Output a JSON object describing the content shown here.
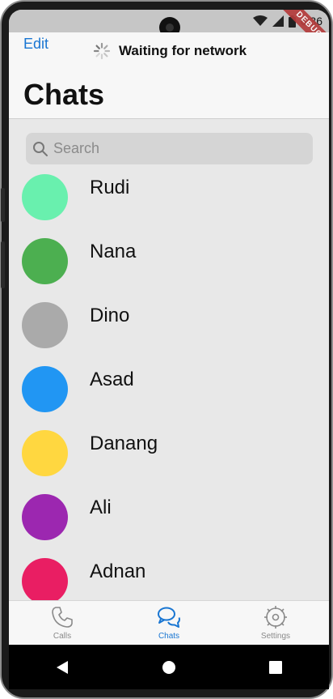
{
  "status_bar": {
    "time": "6:36",
    "debug_label": "DEBUG"
  },
  "header": {
    "edit_label": "Edit",
    "network_status": "Waiting for network",
    "title": "Chats"
  },
  "search": {
    "placeholder": "Search",
    "value": ""
  },
  "chats": [
    {
      "name": "Rudi",
      "color": "#69f0ae"
    },
    {
      "name": "Nana",
      "color": "#4caf50"
    },
    {
      "name": "Dino",
      "color": "#aaaaaa"
    },
    {
      "name": "Asad",
      "color": "#2196f3"
    },
    {
      "name": "Danang",
      "color": "#ffd740"
    },
    {
      "name": "Ali",
      "color": "#9c27b0"
    },
    {
      "name": "Adnan",
      "color": "#e91e63"
    }
  ],
  "tabs": [
    {
      "label": "Calls",
      "icon": "phone-icon",
      "active": false
    },
    {
      "label": "Chats",
      "icon": "chat-bubbles-icon",
      "active": true
    },
    {
      "label": "Settings",
      "icon": "gear-icon",
      "active": false
    }
  ],
  "colors": {
    "accent": "#1976d2",
    "inactive": "#8a8a8a"
  }
}
